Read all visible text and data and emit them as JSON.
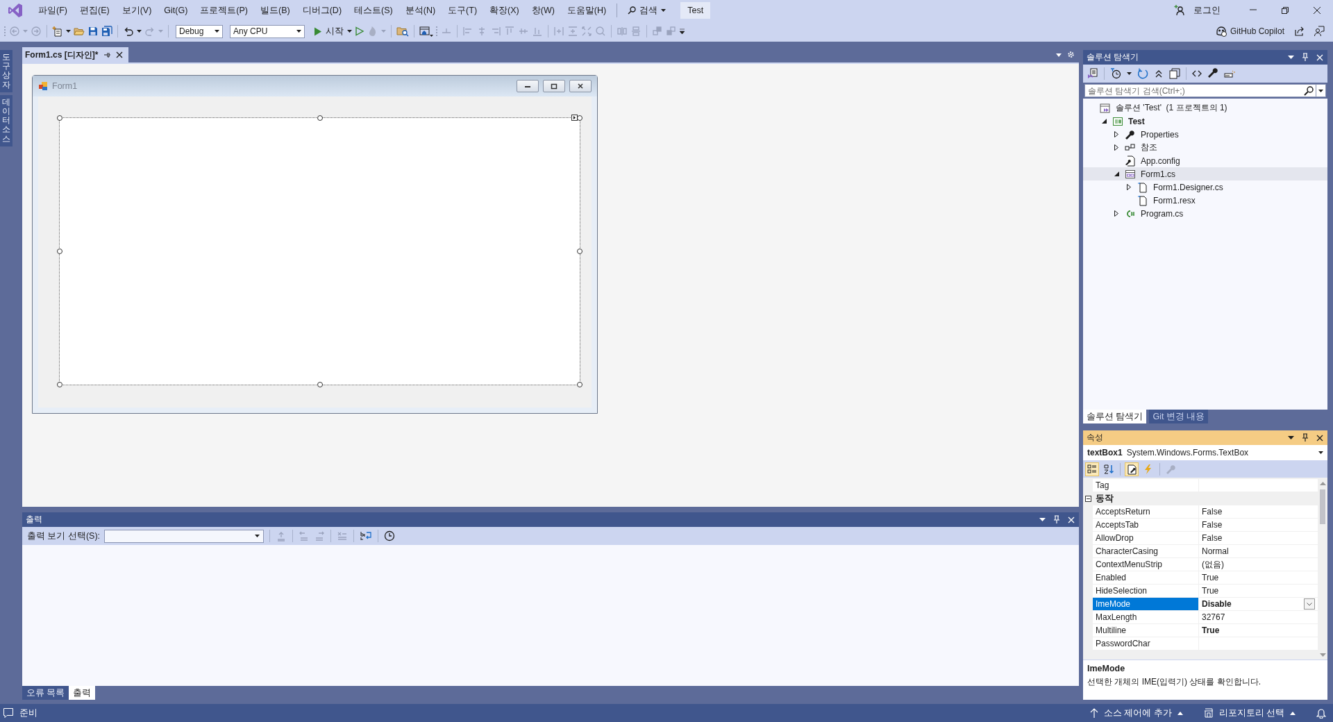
{
  "menu": [
    "파일(F)",
    "편집(E)",
    "보기(V)",
    "Git(G)",
    "프로젝트(P)",
    "빌드(B)",
    "디버그(D)",
    "테스트(S)",
    "분석(N)",
    "도구(T)",
    "확장(X)",
    "창(W)",
    "도움말(H)"
  ],
  "search": "검색",
  "solution_badge": "Test",
  "account": "로그인",
  "toolbar": {
    "configuration": "Debug",
    "platform": "Any CPU",
    "start": "시작",
    "copilot": "GitHub Copilot"
  },
  "side_tabs": [
    "도구 상자",
    "데이터 소스"
  ],
  "document_tabs": [
    {
      "title": "Form1.cs [디자인]*",
      "selected": true
    }
  ],
  "form": {
    "title": "Form1"
  },
  "solution_explorer": {
    "title": "솔루션 탐색기",
    "search_placeholder": "솔루션 탐색기 검색(Ctrl+;)",
    "tree": [
      {
        "label": "솔루션 'Test'  (1 프로젝트의 1)",
        "kind": "solution",
        "selected": false,
        "children": [
          {
            "label": "Test",
            "kind": "project",
            "expanded": true,
            "selected": false,
            "children": [
              {
                "label": "Properties",
                "kind": "properties",
                "expanded": false,
                "selected": false
              },
              {
                "label": "참조",
                "kind": "references",
                "expanded": false,
                "selected": false
              },
              {
                "label": "App.config",
                "kind": "config",
                "selected": false
              },
              {
                "label": "Form1.cs",
                "kind": "form",
                "expanded": true,
                "selected": true,
                "children": [
                  {
                    "label": "Form1.Designer.cs",
                    "kind": "file",
                    "expanded": false,
                    "selected": false
                  },
                  {
                    "label": "Form1.resx",
                    "kind": "file",
                    "selected": false
                  }
                ]
              },
              {
                "label": "Program.cs",
                "kind": "csharp",
                "expanded": false,
                "selected": false
              }
            ]
          }
        ]
      }
    ]
  },
  "panel_tabs": [
    {
      "label": "솔루션 탐색기",
      "selected": true
    },
    {
      "label": "Git 변경 내용",
      "selected": false
    }
  ],
  "properties": {
    "title": "속성",
    "object": "textBox1",
    "type": "System.Windows.Forms.TextBox",
    "tools": [
      {
        "kind": "categorized",
        "selected": true
      },
      {
        "kind": "alphabetical",
        "selected": false
      },
      {
        "kind": "properties",
        "selected": true
      },
      {
        "kind": "events",
        "selected": false
      },
      {
        "kind": "pages",
        "selected": false
      }
    ],
    "rows": [
      {
        "kind": "property",
        "name": "Tag",
        "selected": false
      },
      {
        "kind": "category",
        "name": "동작",
        "expanded": true
      },
      {
        "kind": "property",
        "name": "AcceptsReturn",
        "value": "False",
        "bold": false,
        "selected": false
      },
      {
        "kind": "property",
        "name": "AcceptsTab",
        "value": "False",
        "bold": false,
        "selected": false
      },
      {
        "kind": "property",
        "name": "AllowDrop",
        "value": "False",
        "bold": false,
        "selected": false
      },
      {
        "kind": "property",
        "name": "CharacterCasing",
        "value": "Normal",
        "bold": false,
        "selected": false
      },
      {
        "kind": "property",
        "name": "ContextMenuStrip",
        "value": "(없음)",
        "bold": false,
        "selected": false
      },
      {
        "kind": "property",
        "name": "Enabled",
        "value": "True",
        "bold": false,
        "selected": false
      },
      {
        "kind": "property",
        "name": "HideSelection",
        "value": "True",
        "bold": false,
        "selected": false
      },
      {
        "kind": "property",
        "name": "ImeMode",
        "value": "Disable",
        "bold": true,
        "selected": true
      },
      {
        "kind": "property",
        "name": "MaxLength",
        "value": "32767",
        "bold": false,
        "selected": false
      },
      {
        "kind": "property",
        "name": "Multiline",
        "value": "True",
        "bold": true,
        "selected": false
      },
      {
        "kind": "property",
        "name": "PasswordChar",
        "selected": false
      }
    ],
    "description": {
      "title": "ImeMode",
      "text": "선택한 개체의 IME(입력기) 상태를 확인합니다."
    }
  },
  "output": {
    "title": "출력",
    "source_label": "출력 보기 선택(S):",
    "tabs": [
      {
        "label": "오류 목록",
        "selected": false
      },
      {
        "label": "출력",
        "selected": true
      }
    ]
  },
  "status": {
    "text": "준비",
    "source_control": "소스 제어에 추가",
    "repository": "리포지토리 선택"
  }
}
